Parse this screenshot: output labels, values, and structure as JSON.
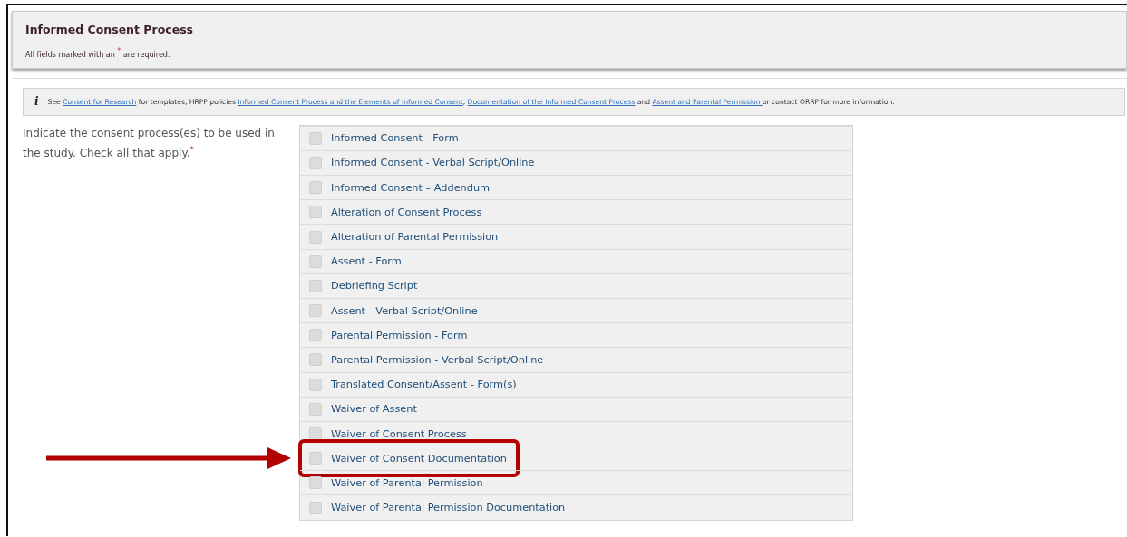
{
  "header": {
    "title": "Informed Consent Process",
    "required_note": {
      "before": "All fields marked with an ",
      "mark": "*",
      "after": " are required."
    }
  },
  "info": {
    "icon": "i",
    "parts": [
      {
        "kind": "text",
        "text": "See "
      },
      {
        "kind": "link",
        "text": "Consent for Research"
      },
      {
        "kind": "text",
        "text": " for templates, HRPP policies "
      },
      {
        "kind": "link",
        "text": "Informed Consent Process and the Elements of Informed Consent"
      },
      {
        "kind": "text",
        "text": ", "
      },
      {
        "kind": "link",
        "text": "Documentation of the Informed Consent Process"
      },
      {
        "kind": "text",
        "text": " and "
      },
      {
        "kind": "link",
        "text": "Assent and Parental Permission "
      },
      {
        "kind": "text",
        "text": "or contact ORRP for more information."
      }
    ]
  },
  "question": {
    "label": "Indicate the consent process(es) to be used in the study. Check all that apply.",
    "mark": "*"
  },
  "options": [
    {
      "label": "Informed Consent - Form",
      "checked": false,
      "highlighted": false
    },
    {
      "label": "Informed Consent - Verbal Script/Online",
      "checked": false,
      "highlighted": false
    },
    {
      "label": "Informed Consent – Addendum",
      "checked": false,
      "highlighted": false
    },
    {
      "label": "Alteration of Consent Process",
      "checked": false,
      "highlighted": false
    },
    {
      "label": "Alteration of Parental Permission",
      "checked": false,
      "highlighted": false
    },
    {
      "label": "Assent - Form",
      "checked": false,
      "highlighted": false
    },
    {
      "label": "Debriefing Script",
      "checked": false,
      "highlighted": false
    },
    {
      "label": "Assent - Verbal Script/Online",
      "checked": false,
      "highlighted": false
    },
    {
      "label": "Parental Permission - Form",
      "checked": false,
      "highlighted": false
    },
    {
      "label": "Parental Permission - Verbal Script/Online",
      "checked": false,
      "highlighted": false
    },
    {
      "label": "Translated Consent/Assent - Form(s)",
      "checked": false,
      "highlighted": false
    },
    {
      "label": "Waiver of Assent",
      "checked": false,
      "highlighted": false
    },
    {
      "label": "Waiver of Consent Process",
      "checked": false,
      "highlighted": false
    },
    {
      "label": "Waiver of Consent Documentation",
      "checked": false,
      "highlighted": true
    },
    {
      "label": "Waiver of Parental Permission",
      "checked": false,
      "highlighted": false
    },
    {
      "label": "Waiver of Parental Permission Documentation",
      "checked": false,
      "highlighted": false
    }
  ]
}
